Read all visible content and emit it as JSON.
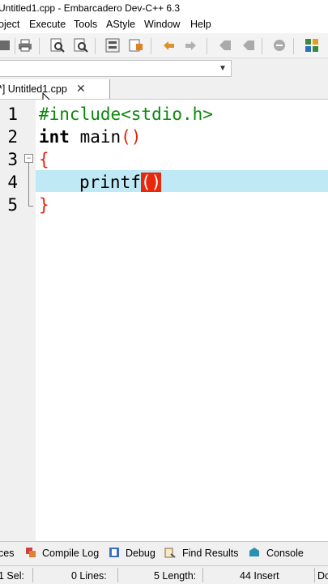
{
  "window": {
    "title": "Untitled1.cpp - Embarcadero Dev-C++ 6.3"
  },
  "menu": [
    "oject",
    "Execute",
    "Tools",
    "AStyle",
    "Window",
    "Help"
  ],
  "tab": {
    "label": "*] Untitled1.cpp",
    "close": "✕"
  },
  "editor": {
    "line_numbers": [
      "1",
      "2",
      "3",
      "4",
      "5"
    ],
    "lines": {
      "l1": "#include<stdio.h>",
      "l2_kw": "int",
      "l2_rest": " main",
      "l2_paren": "()",
      "l3": "{",
      "l4_text": "printf",
      "l4_open": "(",
      "l4_close": ")",
      "l5": "}"
    },
    "fold_marker": "⊟"
  },
  "bottom_tabs": [
    "ces",
    "Compile Log",
    "Debug",
    "Find Results",
    "Console"
  ],
  "status": {
    "line": "1 Sel:",
    "sel": "0 Lines:",
    "lines": "5 Length:",
    "length": "44 Insert",
    "mode": "Do"
  }
}
